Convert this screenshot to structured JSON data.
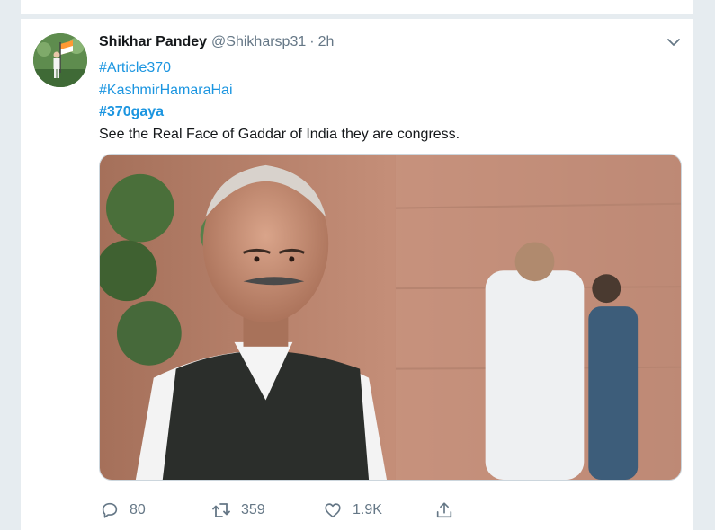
{
  "tweet": {
    "author_name": "Shikhar Pandey",
    "author_handle": "@Shikharsp31",
    "separator": "·",
    "time": "2h",
    "hashtags": [
      "#Article370",
      "#KashmirHamaraHai",
      "#370gaya"
    ],
    "text": "See the Real Face of Gaddar of India they are congress.",
    "replies": "80",
    "retweets": "359",
    "likes": "1.9K"
  },
  "icons": {
    "caret": "chevron-down-icon",
    "reply": "reply-icon",
    "retweet": "retweet-icon",
    "like": "heart-icon",
    "share": "share-icon"
  },
  "colors": {
    "link": "#1b95e0",
    "muted": "#657786",
    "text": "#14171a",
    "border": "#e6ecf0"
  }
}
